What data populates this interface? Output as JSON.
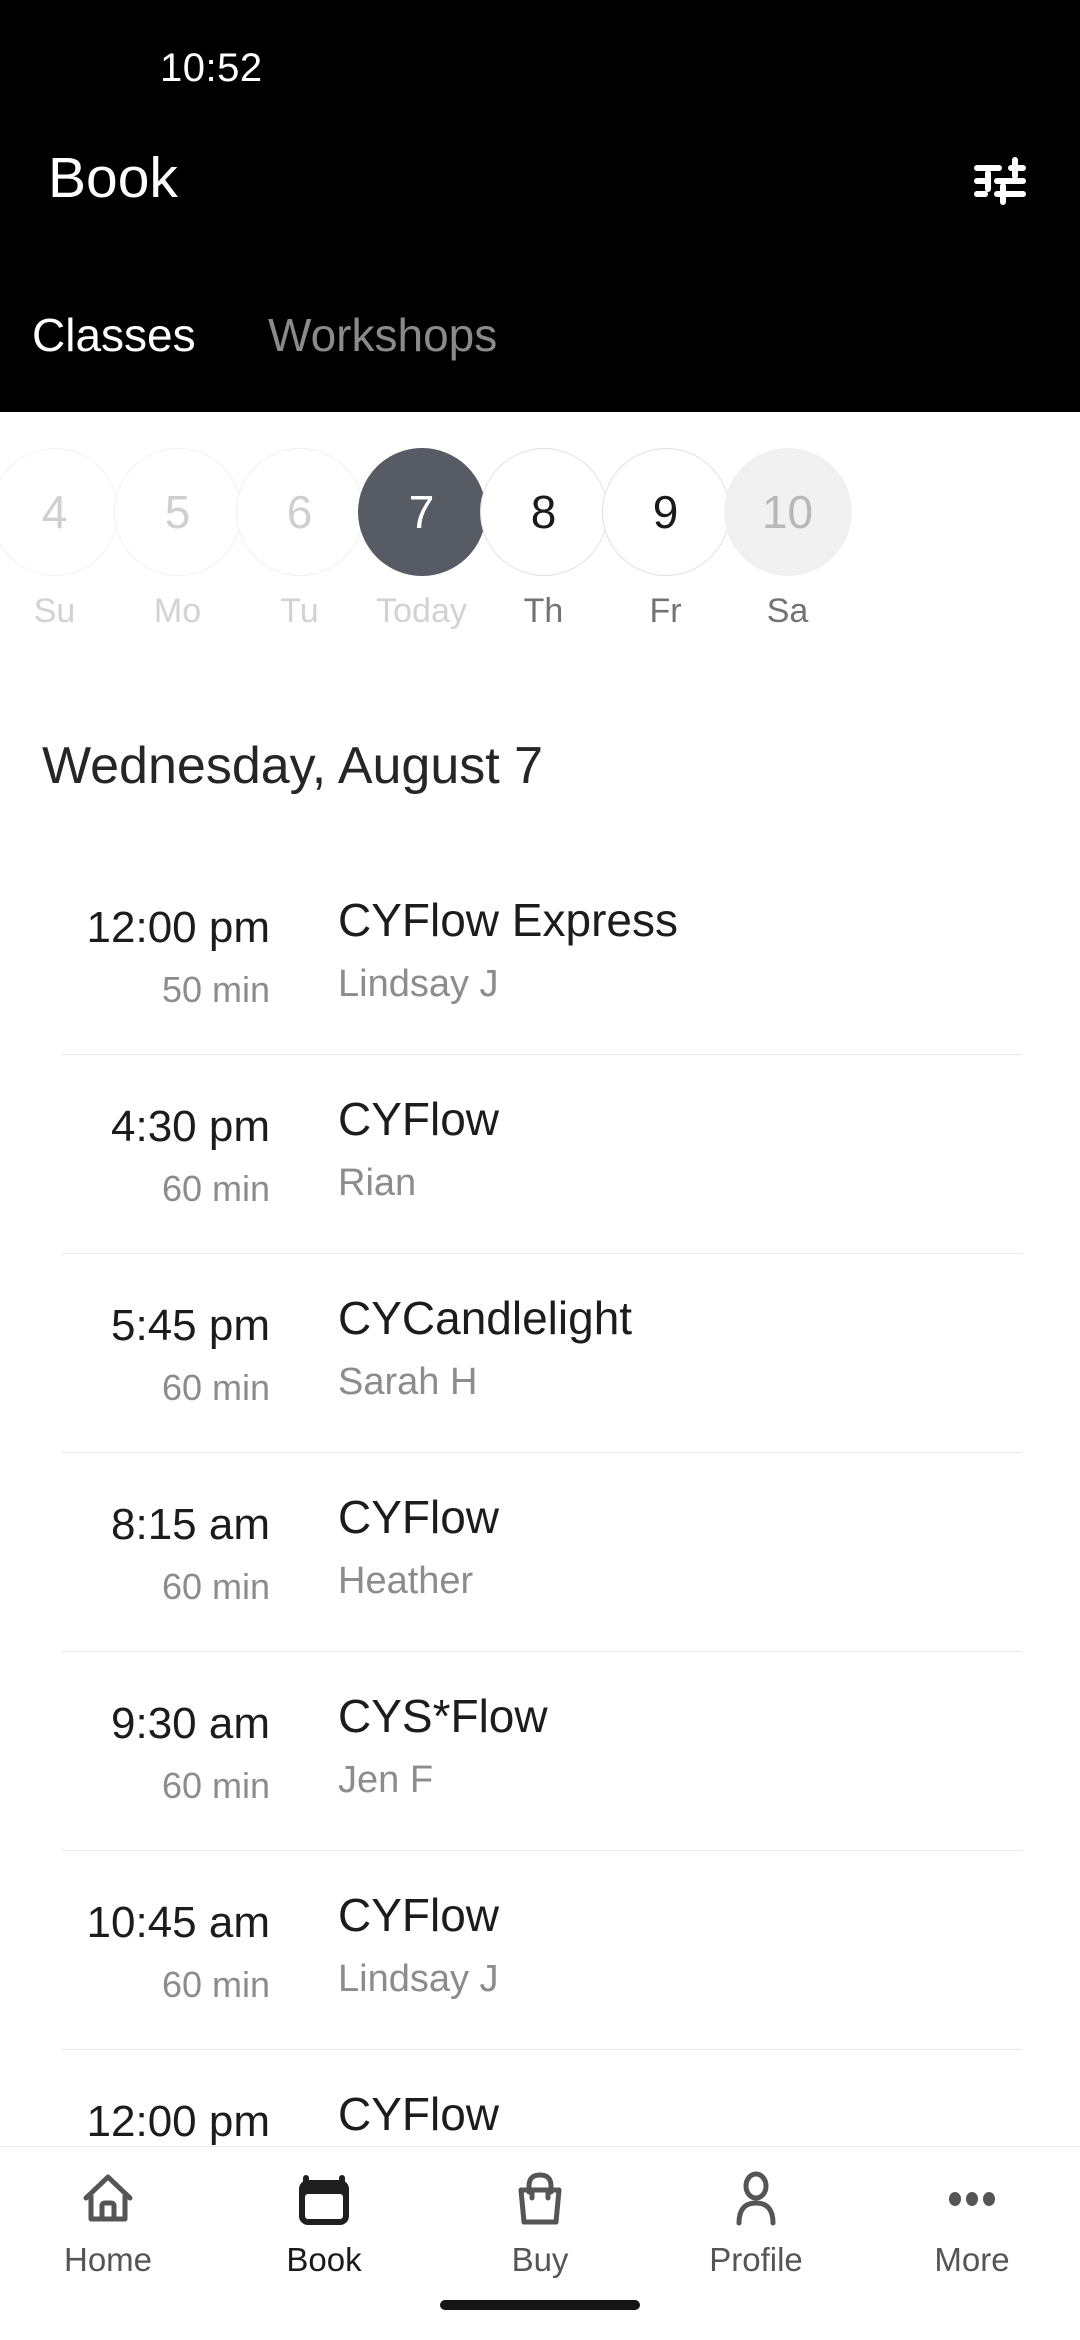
{
  "status_bar": {
    "time": "10:52"
  },
  "header": {
    "title": "Book",
    "filter_icon": "sliders-filter-icon",
    "tabs": [
      {
        "label": "Classes",
        "active": true
      },
      {
        "label": "Workshops",
        "active": false
      }
    ]
  },
  "date_strip": {
    "days": [
      {
        "date": "4",
        "label": "Su",
        "state": "past"
      },
      {
        "date": "5",
        "label": "Mo",
        "state": "past"
      },
      {
        "date": "6",
        "label": "Tu",
        "state": "past"
      },
      {
        "date": "7",
        "label": "Today",
        "state": "selected"
      },
      {
        "date": "8",
        "label": "Th",
        "state": "future"
      },
      {
        "date": "9",
        "label": "Fr",
        "state": "future"
      },
      {
        "date": "10",
        "label": "Sa",
        "state": "muted"
      }
    ],
    "selected_color": "#565b64"
  },
  "schedule": {
    "heading": "Wednesday, August 7",
    "classes": [
      {
        "time": "12:00 pm",
        "duration": "50 min",
        "name": "CYFlow Express",
        "instructor": "Lindsay J"
      },
      {
        "time": "4:30 pm",
        "duration": "60 min",
        "name": "CYFlow",
        "instructor": "Rian"
      },
      {
        "time": "5:45 pm",
        "duration": "60 min",
        "name": "CYCandlelight",
        "instructor": "Sarah H"
      },
      {
        "time": "8:15 am",
        "duration": "60 min",
        "name": "CYFlow",
        "instructor": "Heather"
      },
      {
        "time": "9:30 am",
        "duration": "60 min",
        "name": "CYS*Flow",
        "instructor": "Jen F"
      },
      {
        "time": "10:45 am",
        "duration": "60 min",
        "name": "CYFlow",
        "instructor": "Lindsay J"
      },
      {
        "time": "12:00 pm",
        "duration": "",
        "name": "CYFlow",
        "instructor": ""
      }
    ]
  },
  "bottom_nav": {
    "items": [
      {
        "label": "Home",
        "icon": "house-icon",
        "active": false
      },
      {
        "label": "Book",
        "icon": "calendar-icon",
        "active": true
      },
      {
        "label": "Buy",
        "icon": "shopping-bag-icon",
        "active": false
      },
      {
        "label": "Profile",
        "icon": "person-icon",
        "active": false
      },
      {
        "label": "More",
        "icon": "three-dots-icon",
        "active": false
      }
    ]
  }
}
